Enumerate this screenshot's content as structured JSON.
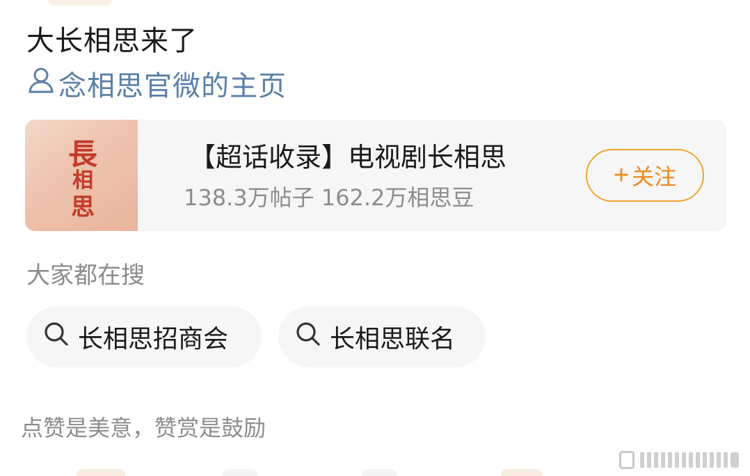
{
  "post": {
    "text": "大长相思来了",
    "author_link": "念相思官微的主页"
  },
  "topic_card": {
    "cover_chars": [
      "長",
      "相",
      "思"
    ],
    "title": "【超话收录】电视剧长相思",
    "meta": "138.3万帖子 162.2万相思豆",
    "follow_label": "关注",
    "follow_plus": "+",
    "accent_color": "#ee8a1c"
  },
  "search": {
    "heading": "大家都在搜",
    "chips": [
      {
        "label": "长相思招商会",
        "icon": "search-icon"
      },
      {
        "label": "长相思联名",
        "icon": "search-icon"
      }
    ]
  },
  "footer": {
    "text": "点赞是美意，赞赏是鼓励"
  },
  "icons": {
    "author": "user-icon",
    "search": "search-icon"
  }
}
